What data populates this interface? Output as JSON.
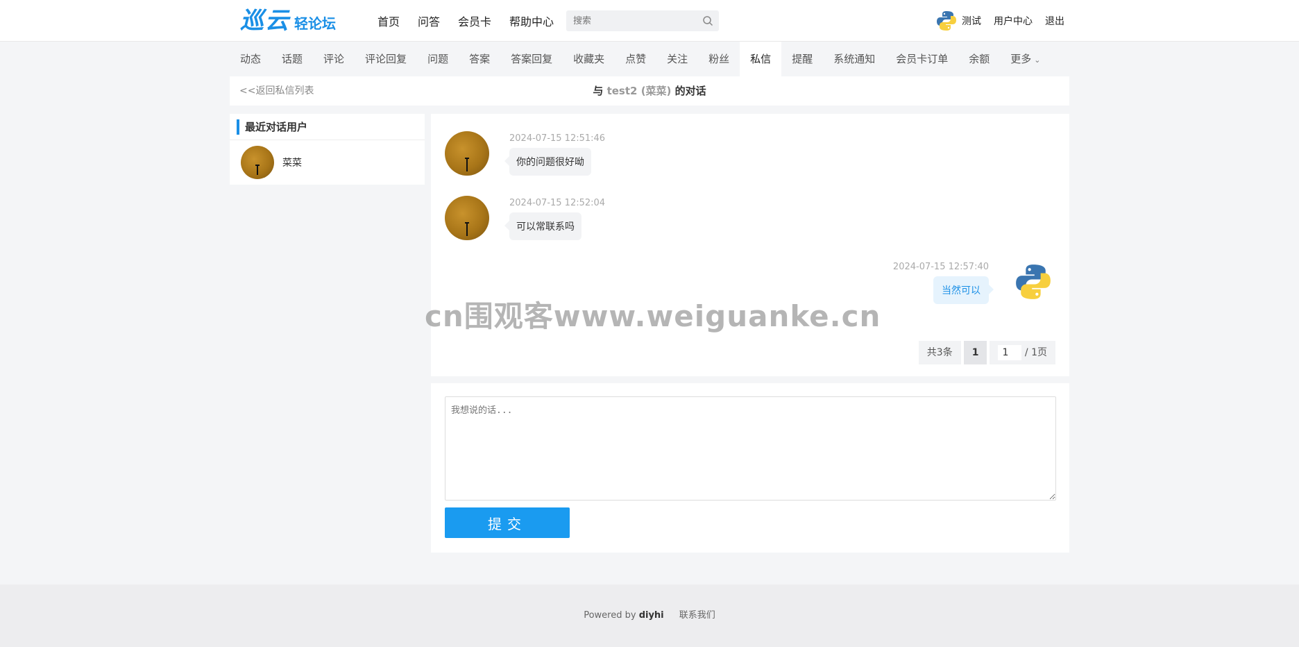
{
  "header": {
    "logo_main": "巡云",
    "logo_sub": "轻论坛",
    "nav": [
      "首页",
      "问答",
      "会员卡",
      "帮助中心"
    ],
    "search_placeholder": "搜索",
    "user_name": "测试",
    "user_center": "用户中心",
    "logout": "退出"
  },
  "subnav": {
    "items": [
      "动态",
      "话题",
      "评论",
      "评论回复",
      "问题",
      "答案",
      "答案回复",
      "收藏夹",
      "点赞",
      "关注",
      "粉丝",
      "私信",
      "提醒",
      "系统通知",
      "会员卡订单",
      "余额",
      "更多"
    ],
    "active": "私信"
  },
  "conversation": {
    "back_link": "<<返回私信列表",
    "title_prefix": "与",
    "peer_account": "test2",
    "peer_nickname": "(菜菜)",
    "title_suffix": "的对话"
  },
  "recent": {
    "heading": "最近对话用户",
    "users": [
      {
        "name": "菜菜"
      }
    ]
  },
  "messages": [
    {
      "direction": "in",
      "time": "2024-07-15 12:51:46",
      "text": "你的问题很好呦"
    },
    {
      "direction": "in",
      "time": "2024-07-15 12:52:04",
      "text": "可以常联系吗"
    },
    {
      "direction": "out",
      "time": "2024-07-15 12:57:40",
      "text": "当然可以"
    }
  ],
  "pagination": {
    "total_label": "共3条",
    "current_page": "1",
    "jump_value": "1",
    "total_pages_label": "/ 1页"
  },
  "watermark": "cn围观客www.weiguanke.cn",
  "reply": {
    "placeholder": "我想说的话...",
    "submit_label": "提交"
  },
  "footer": {
    "powered_by": "Powered by",
    "brand": "diyhi",
    "contact": "联系我们"
  },
  "colors": {
    "accent": "#1a8fe6",
    "submit_button": "#1a9bf0",
    "page_bg": "#f4f5f7"
  }
}
